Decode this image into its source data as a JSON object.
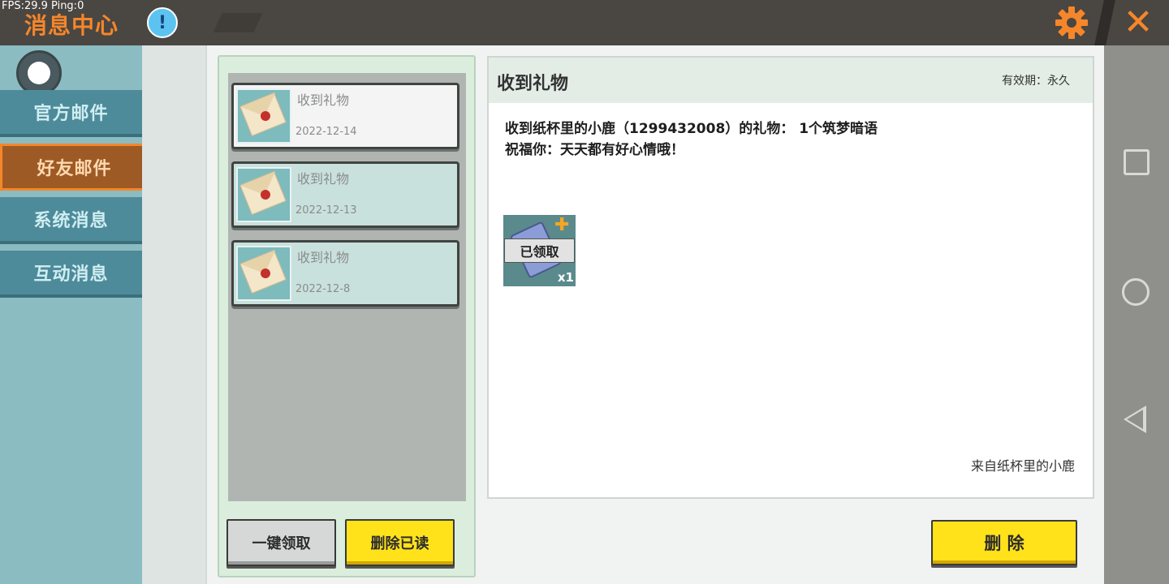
{
  "header": {
    "fps_text": "FPS:29.9  Ping:0",
    "title": "消息中心",
    "info_icon": "info-icon",
    "info_glyph": "!",
    "settings_icon": "gear-icon",
    "close_icon": "close-icon",
    "close_glyph": "✕",
    "accent_color": "#f5862a"
  },
  "sidebar": {
    "tabs": [
      {
        "label": "官方邮件",
        "active": false
      },
      {
        "label": "好友邮件",
        "active": true
      },
      {
        "label": "系统消息",
        "active": false
      },
      {
        "label": "互动消息",
        "active": false
      }
    ]
  },
  "mail_list": {
    "items": [
      {
        "title": "收到礼物",
        "date": "2022-12-14",
        "selected": true
      },
      {
        "title": "收到礼物",
        "date": "2022-12-13",
        "selected": false
      },
      {
        "title": "收到礼物",
        "date": "2022-12-8",
        "selected": false
      }
    ],
    "claim_all_label": "一键领取",
    "delete_read_label": "删除已读"
  },
  "detail": {
    "title": "收到礼物",
    "validity": "有效期：永久",
    "line1": "收到纸杯里的小鹿（1299432008）的礼物： 1个筑梦暗语",
    "line2": "祝福你：天天都有好心情哦！",
    "attachment": {
      "status": "已领取",
      "quantity": "x1",
      "badge_glyph": "✚"
    },
    "sender": "来自纸杯里的小鹿",
    "delete_label": "删 除"
  },
  "system_nav": {
    "recent_icon": "square-icon",
    "home_icon": "circle-icon",
    "back_icon": "back-triangle-icon"
  }
}
